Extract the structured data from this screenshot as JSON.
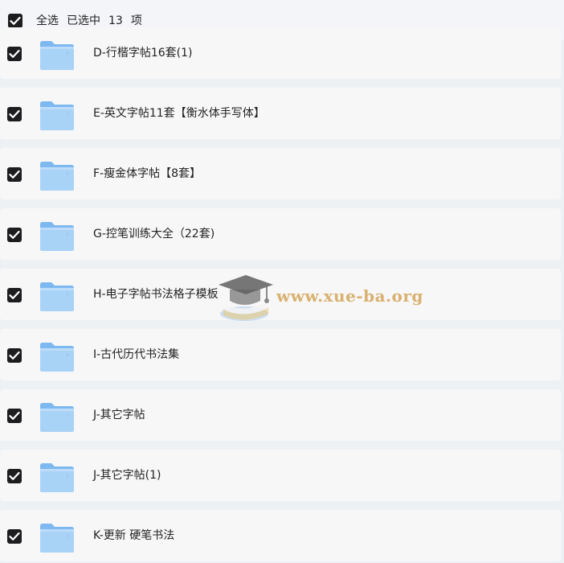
{
  "header": {
    "select_all_label": "全选",
    "selected_text": "已选中",
    "selected_count": "13",
    "unit": "项"
  },
  "rows": [
    {
      "label": "D-行楷字帖16套(1)",
      "checked": true
    },
    {
      "label": "E-英文字帖11套【衡水体手写体】",
      "checked": true
    },
    {
      "label": "F-瘦金体字帖【8套】",
      "checked": true
    },
    {
      "label": "G-控笔训练大全（22套)",
      "checked": true
    },
    {
      "label": "H-电子字帖书法格子模板",
      "checked": true
    },
    {
      "label": "I-古代历代书法集",
      "checked": true
    },
    {
      "label": "J-其它字帖",
      "checked": true
    },
    {
      "label": "J-其它字帖(1)",
      "checked": true
    },
    {
      "label": "K-更新 硬笔书法",
      "checked": true
    }
  ],
  "watermark": {
    "text": "www.xue-ba.org"
  },
  "colors": {
    "checkbox_bg": "#1d1d1f",
    "folder_light": "#a9d2f7",
    "folder_dark": "#6fb0ef",
    "row_bg": "#f7f7f8"
  },
  "icons": {
    "checkbox": "check-icon",
    "folder": "folder-icon",
    "watermark": "graduation-cap-icon"
  }
}
